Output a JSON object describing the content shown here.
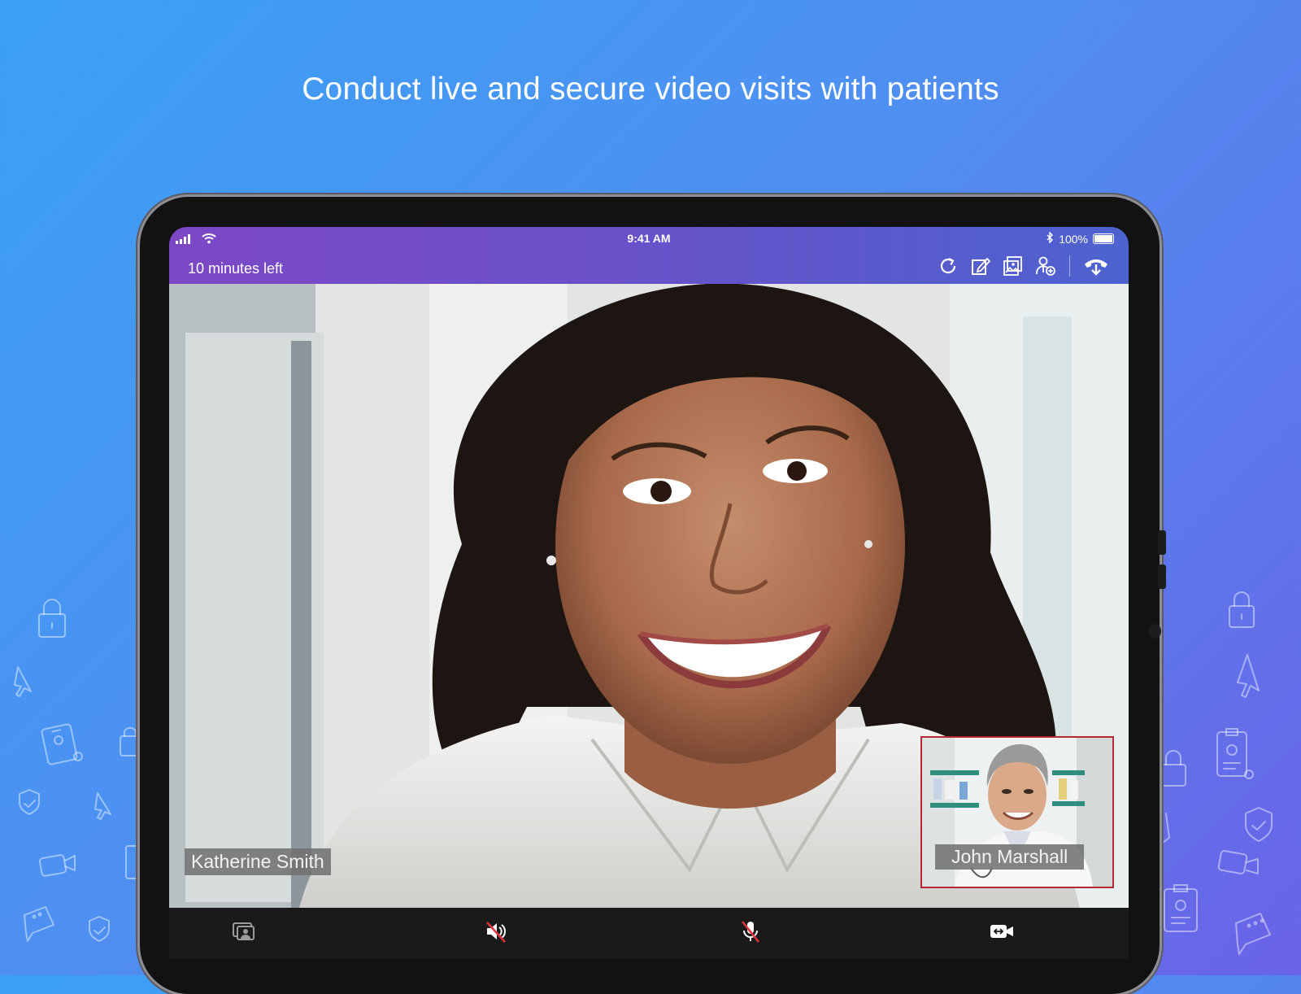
{
  "headline": "Conduct live and secure video visits with patients",
  "status_bar": {
    "time": "9:41 AM",
    "battery": "100%",
    "icons": [
      "signal-icon",
      "wifi-icon",
      "bluetooth-icon",
      "battery-icon"
    ]
  },
  "call_header": {
    "time_left": "10 minutes left",
    "actions": [
      "refresh-icon",
      "notes-icon",
      "gallery-icon",
      "add-participant-icon",
      "end-call-icon"
    ]
  },
  "participants": {
    "main": "Katherine Smith",
    "self": "John Marshall"
  },
  "bottom_controls": [
    "screen-share-icon",
    "speaker-muted-icon",
    "mic-muted-icon",
    "switch-camera-icon"
  ],
  "colors": {
    "header_start": "#7c47c5",
    "header_end": "#4d63cf",
    "pip_border": "#b32a35",
    "mute_slash": "#e0323c"
  }
}
